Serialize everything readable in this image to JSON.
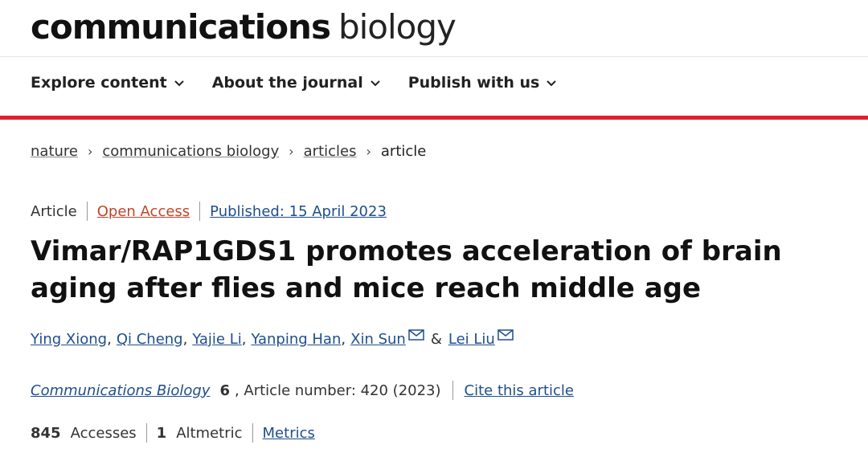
{
  "header": {
    "logo_bold": "communications",
    "logo_light": "biology",
    "nav": [
      {
        "label": "Explore content"
      },
      {
        "label": "About the journal"
      },
      {
        "label": "Publish with us"
      }
    ]
  },
  "breadcrumb": {
    "items": [
      "nature",
      "communications biology",
      "articles",
      "article"
    ]
  },
  "meta": {
    "type": "Article",
    "access": "Open Access",
    "published": "Published: 15 April 2023"
  },
  "article": {
    "title": "Vimar/RAP1GDS1 promotes acceleration of brain aging after flies and mice reach middle age",
    "authors": [
      "Ying Xiong",
      "Qi Cheng",
      "Yajie Li",
      "Yanping Han",
      "Xin Sun",
      "Lei Liu"
    ],
    "ampersand": "&"
  },
  "citation": {
    "journal": "Communications Biology",
    "volume": "6",
    "article_number": ", Article number: 420 (2023)",
    "cite_label": "Cite this article"
  },
  "metrics": {
    "accesses_count": "845",
    "accesses_label": "Accesses",
    "altmetric_count": "1",
    "altmetric_label": "Altmetric",
    "metrics_link": "Metrics"
  },
  "colors": {
    "accent_red": "#e0202c",
    "link_blue": "#1f4e8c",
    "open_access": "#c0452b"
  },
  "icons": {
    "nav_chevron": "chevron-down-icon",
    "author_contact": "mail-icon",
    "breadcrumb_separator": "chevron-right-icon"
  }
}
